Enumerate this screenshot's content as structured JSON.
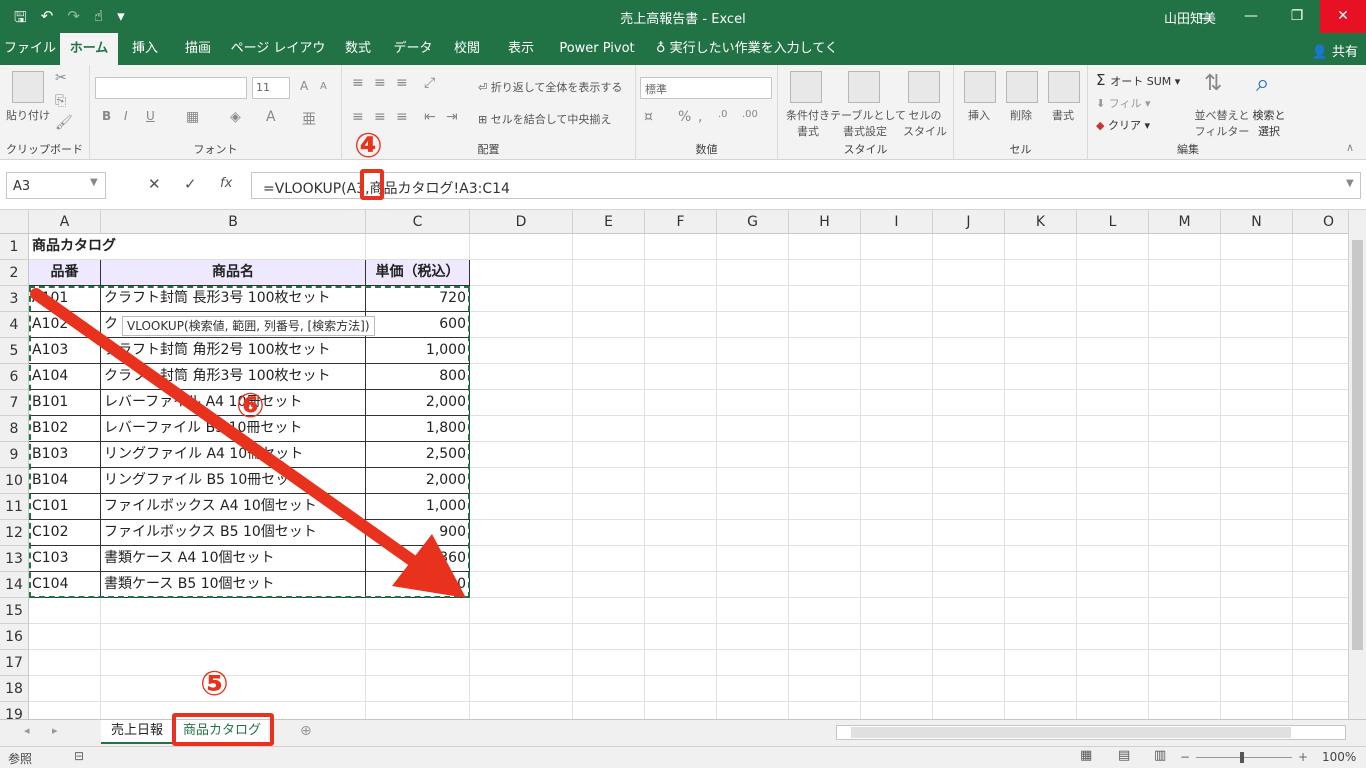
{
  "window": {
    "title": "売上高報告書  -  Excel",
    "user": "山田知美",
    "share": "共有"
  },
  "tabs": [
    "ファイル",
    "ホーム",
    "挿入",
    "描画",
    "ページ レイアウト",
    "数式",
    "データ",
    "校閲",
    "表示",
    "Power Pivot",
    "実行したい作業を入力してください"
  ],
  "ribbon": {
    "clipboard": {
      "label": "クリップボード",
      "paste": "貼り付け"
    },
    "font": {
      "label": "フォント",
      "size": "11",
      "bold": "B",
      "italic": "I",
      "underline": "U"
    },
    "alignment": {
      "label": "配置",
      "wrap": "折り返して全体を表示する",
      "merge": "セルを結合して中央揃え"
    },
    "number": {
      "label": "数値",
      "format": "標準"
    },
    "styles": {
      "label": "スタイル",
      "cond1": "条件付き",
      "cond2": "書式",
      "table1": "テーブルとして",
      "table2": "書式設定",
      "cell1": "セルの",
      "cell2": "スタイル"
    },
    "cells": {
      "label": "セル",
      "insert": "挿入",
      "delete": "削除",
      "format": "書式"
    },
    "editing": {
      "label": "編集",
      "autosum": "オート SUM",
      "fill": "フィル",
      "clear": "クリア",
      "sort1": "並べ替えと",
      "sort2": "フィルター",
      "find1": "検索と",
      "find2": "選択"
    }
  },
  "formula_bar": {
    "name_box": "A3",
    "formula": "=VLOOKUP(A3,商品カタログ!A3:C14",
    "fx": "fx"
  },
  "columns": [
    "A",
    "B",
    "C",
    "D",
    "E",
    "F",
    "G",
    "H",
    "I",
    "J",
    "K",
    "L",
    "M",
    "N",
    "O"
  ],
  "rows": [
    "1",
    "2",
    "3",
    "4",
    "5",
    "6",
    "7",
    "8",
    "9",
    "10",
    "11",
    "12",
    "13",
    "14",
    "15",
    "16",
    "17",
    "18",
    "19"
  ],
  "sheet": {
    "title": "商品カタログ",
    "headers": [
      "品番",
      "商品名",
      "単価（税込）"
    ],
    "data": [
      [
        "A101",
        "クラフト封筒 長形3号 100枚セット",
        "720"
      ],
      [
        "A102",
        "ク",
        "600"
      ],
      [
        "A103",
        "クラフト封筒 角形2号 100枚セット",
        "1,000"
      ],
      [
        "A104",
        "クラフト封筒 角形3号 100枚セット",
        "800"
      ],
      [
        "B101",
        "レバーファイル A4 10冊セット",
        "2,000"
      ],
      [
        "B102",
        "レバーファイル B5 10冊セット",
        "1,800"
      ],
      [
        "B103",
        "リングファイル A4 10冊セット",
        "2,500"
      ],
      [
        "B104",
        "リングファイル B5 10冊セット",
        "2,000"
      ],
      [
        "C101",
        "ファイルボックス A4 10個セット",
        "1,000"
      ],
      [
        "C102",
        "ファイルボックス B5 10個セット",
        "900"
      ],
      [
        "C103",
        "書類ケース A4 10個セット",
        "1,360"
      ],
      [
        "C104",
        "書類ケース B5 10個セット",
        "1,200"
      ]
    ]
  },
  "tooltip": "VLOOKUP(検索値, 範囲, 列番号, [検索方法])",
  "sheet_tabs": [
    "売上日報",
    "商品カタログ"
  ],
  "status": {
    "mode": "参照",
    "zoom": "100%"
  },
  "annotations": {
    "c4": "④",
    "c5": "⑤",
    "c6": "⑥"
  },
  "colors": {
    "excel_green": "#217346",
    "callout_red": "#e8321e",
    "header_fill": "#efe9ff"
  }
}
